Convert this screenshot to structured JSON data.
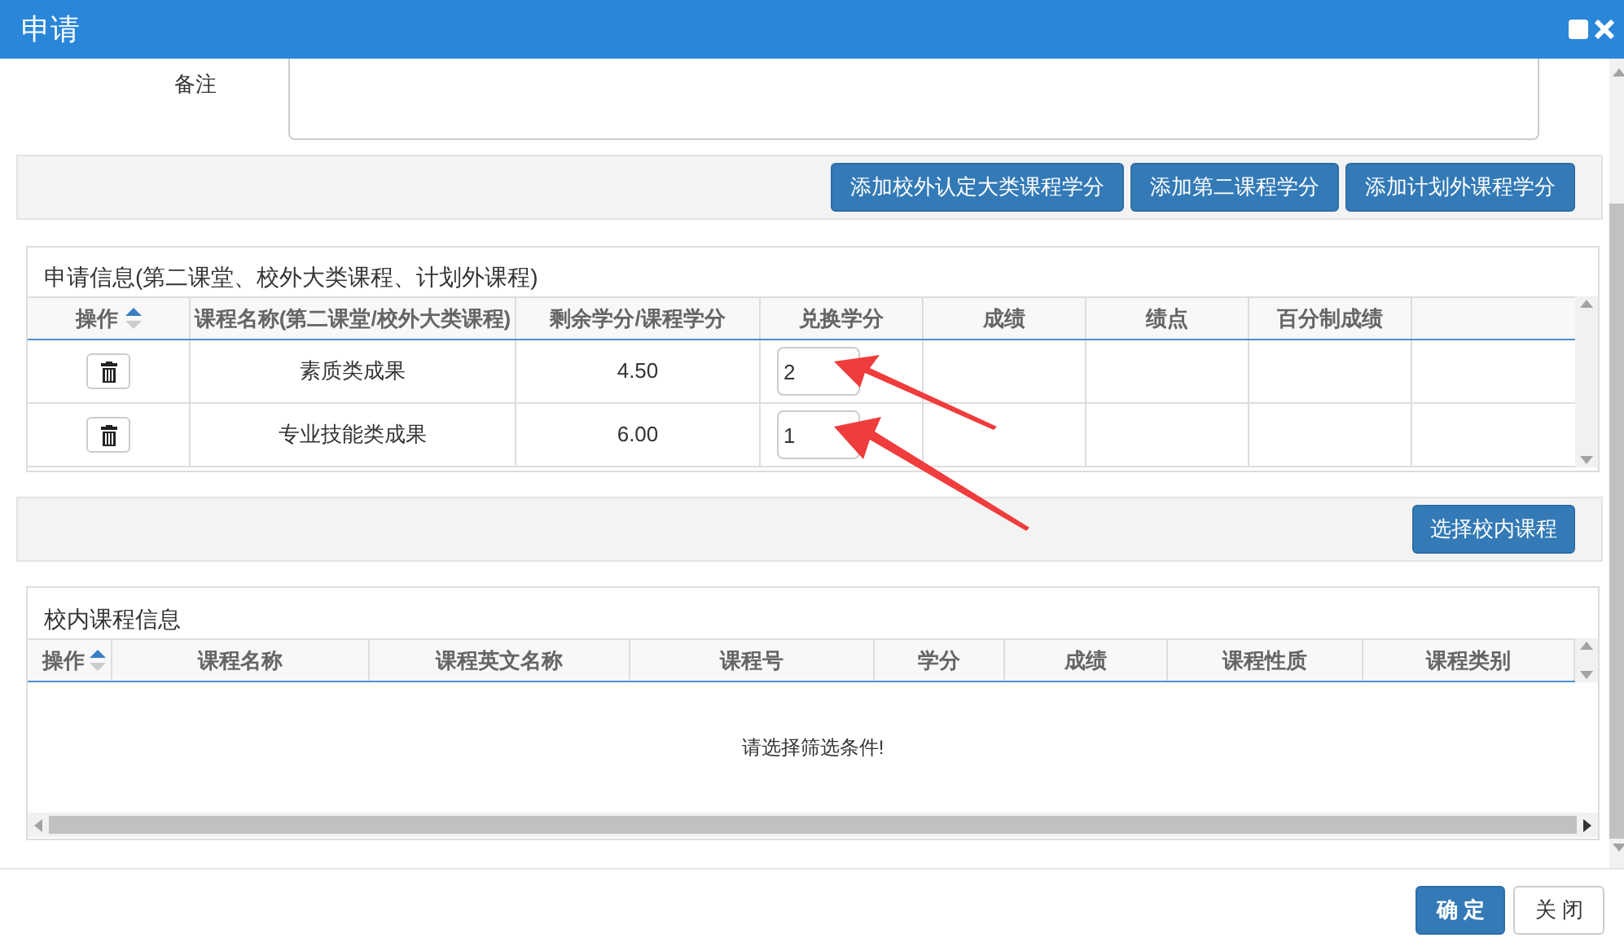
{
  "window": {
    "title": "申请"
  },
  "remark": {
    "label": "备注"
  },
  "toolbar_buttons": [
    "添加校外认定大类课程学分",
    "添加第二课程学分",
    "添加计划外课程学分"
  ],
  "apply_panel": {
    "title": "申请信息(第二课堂、校外大类课程、计划外课程)",
    "columns": [
      "操作",
      "课程名称(第二课堂/校外大类课程)",
      "剩余学分/课程学分",
      "兑换学分",
      "成绩",
      "绩点",
      "百分制成绩"
    ],
    "rows": [
      {
        "name": "素质类成果",
        "remaining": "4.50",
        "exchange": "2"
      },
      {
        "name": "专业技能类成果",
        "remaining": "6.00",
        "exchange": "1"
      }
    ]
  },
  "select_button": "选择校内课程",
  "course_panel": {
    "title": "校内课程信息",
    "columns": [
      "操作",
      "课程名称",
      "课程英文名称",
      "课程号",
      "学分",
      "成绩",
      "课程性质",
      "课程类别"
    ],
    "empty_message": "请选择筛选条件!"
  },
  "footer_buttons": [
    {
      "label": "确 定",
      "kind": "primary"
    },
    {
      "label": "关 闭",
      "kind": "default"
    }
  ]
}
